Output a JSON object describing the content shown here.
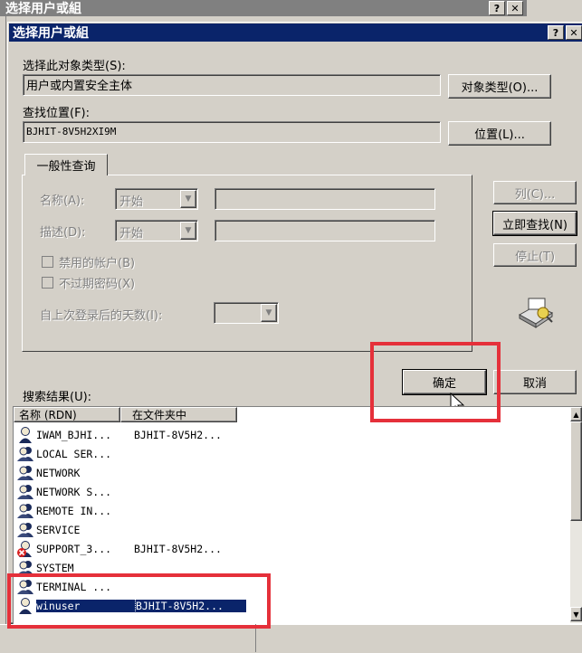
{
  "back_window": {
    "title": "选择用户或組",
    "help": "?",
    "close": "✕"
  },
  "dialog": {
    "title": "选择用户或組",
    "help": "?",
    "close": "✕",
    "object_type_label": "选择此对象类型(S):",
    "object_type_value": "用户或内置安全主体",
    "object_type_button": "对象类型(O)...",
    "location_label": "查找位置(F):",
    "location_value": "BJHIT-8V5H2XI9M",
    "location_button": "位置(L)...",
    "tab_label": "一般性查询",
    "name_label": "名称(A):",
    "name_op": "开始",
    "desc_label": "描述(D):",
    "desc_op": "开始",
    "disabled_accounts": "禁用的帐户(B)",
    "no_expire_password": "不过期密码(X)",
    "days_since_logon": "自上次登录后的天数(I):",
    "columns_button": "列(C)...",
    "find_now_button": "立即查找(N)",
    "stop_button": "停止(T)",
    "ok_button": "确定",
    "cancel_button": "取消",
    "results_label": "搜索结果(U):",
    "col_name": "名称 (RDN)",
    "col_folder": "在文件夹中"
  },
  "results": [
    {
      "name": "IWAM_BJHI...",
      "folder": "BJHIT-8V5H2...",
      "icon": "user-icon"
    },
    {
      "name": "LOCAL SER...",
      "folder": "",
      "icon": "group-icon"
    },
    {
      "name": "NETWORK",
      "folder": "",
      "icon": "group-icon"
    },
    {
      "name": "NETWORK S...",
      "folder": "",
      "icon": "group-icon"
    },
    {
      "name": "REMOTE IN...",
      "folder": "",
      "icon": "group-icon"
    },
    {
      "name": "SERVICE",
      "folder": "",
      "icon": "group-icon"
    },
    {
      "name": "SUPPORT_3...",
      "folder": "BJHIT-8V5H2...",
      "icon": "disabled-user-icon"
    },
    {
      "name": "SYSTEM",
      "folder": "",
      "icon": "group-icon"
    },
    {
      "name": "TERMINAL ...",
      "folder": "",
      "icon": "group-icon"
    },
    {
      "name": "winuser",
      "folder": "BJHIT-8V5H2...",
      "icon": "user-icon",
      "selected": true
    }
  ],
  "colors": {
    "title_bar": "#0a246a",
    "title_bar_back": "#808080",
    "face": "#d4d0c8",
    "selection": "#0a246a",
    "highlight_box": "#e5303a"
  }
}
